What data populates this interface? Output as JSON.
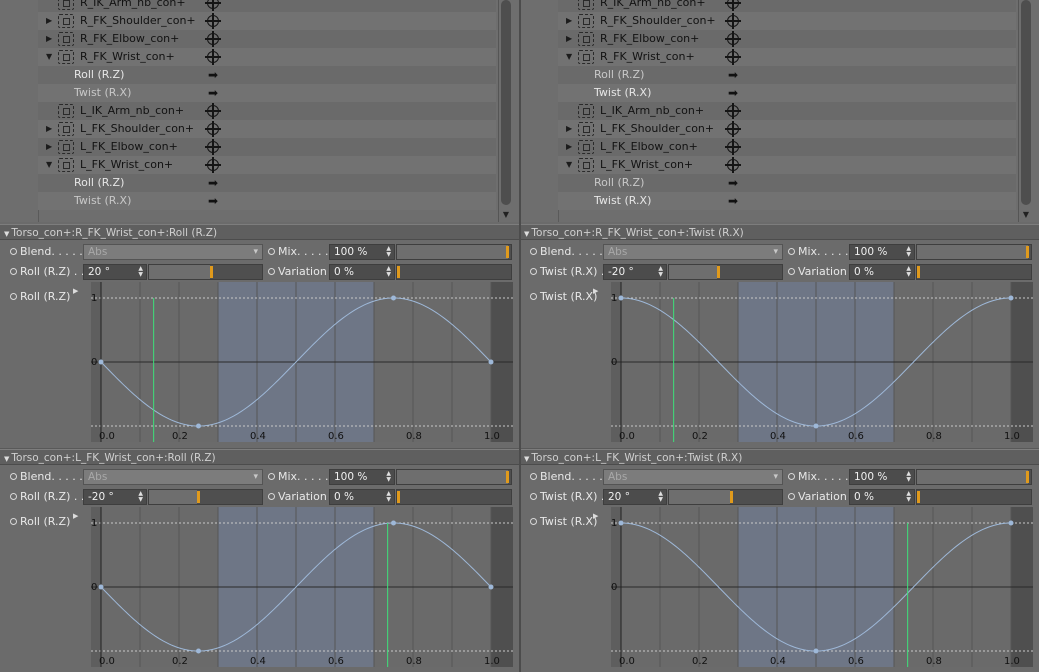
{
  "tree_left": {
    "rows": [
      {
        "kind": "ctrl",
        "expander": "",
        "label": "R_IK_Arm_nb_con+",
        "icon": "target-icon"
      },
      {
        "kind": "ctrl",
        "expander": "▶",
        "label": "R_FK_Shoulder_con+",
        "icon": "target-icon"
      },
      {
        "kind": "ctrl",
        "expander": "▶",
        "label": "R_FK_Elbow_con+",
        "icon": "target-icon"
      },
      {
        "kind": "ctrl",
        "expander": "▼",
        "label": "R_FK_Wrist_con+",
        "icon": "target-icon"
      },
      {
        "kind": "param",
        "label": "Roll (R.Z)",
        "icon": "arrow-right-icon",
        "highlight": true
      },
      {
        "kind": "param",
        "label": "Twist (R.X)",
        "icon": "arrow-right-icon",
        "highlight": false
      },
      {
        "kind": "ctrl",
        "expander": "",
        "label": "L_IK_Arm_nb_con+",
        "icon": "target-icon"
      },
      {
        "kind": "ctrl",
        "expander": "▶",
        "label": "L_FK_Shoulder_con+",
        "icon": "target-icon"
      },
      {
        "kind": "ctrl",
        "expander": "▶",
        "label": "L_FK_Elbow_con+",
        "icon": "target-icon"
      },
      {
        "kind": "ctrl",
        "expander": "▼",
        "label": "L_FK_Wrist_con+",
        "icon": "target-icon"
      },
      {
        "kind": "param",
        "label": "Roll (R.Z)",
        "icon": "arrow-right-icon",
        "highlight": true
      },
      {
        "kind": "param",
        "label": "Twist (R.X)",
        "icon": "arrow-right-icon",
        "highlight": false
      }
    ]
  },
  "tree_right": {
    "rows": [
      {
        "kind": "ctrl",
        "expander": "",
        "label": "R_IK_Arm_nb_con+",
        "icon": "target-icon"
      },
      {
        "kind": "ctrl",
        "expander": "▶",
        "label": "R_FK_Shoulder_con+",
        "icon": "target-icon"
      },
      {
        "kind": "ctrl",
        "expander": "▶",
        "label": "R_FK_Elbow_con+",
        "icon": "target-icon"
      },
      {
        "kind": "ctrl",
        "expander": "▼",
        "label": "R_FK_Wrist_con+",
        "icon": "target-icon"
      },
      {
        "kind": "param",
        "label": "Roll (R.Z)",
        "icon": "arrow-right-icon",
        "highlight": false
      },
      {
        "kind": "param",
        "label": "Twist (R.X)",
        "icon": "arrow-right-icon",
        "highlight": true
      },
      {
        "kind": "ctrl",
        "expander": "",
        "label": "L_IK_Arm_nb_con+",
        "icon": "target-icon"
      },
      {
        "kind": "ctrl",
        "expander": "▶",
        "label": "L_FK_Shoulder_con+",
        "icon": "target-icon"
      },
      {
        "kind": "ctrl",
        "expander": "▶",
        "label": "L_FK_Elbow_con+",
        "icon": "target-icon"
      },
      {
        "kind": "ctrl",
        "expander": "▼",
        "label": "L_FK_Wrist_con+",
        "icon": "target-icon"
      },
      {
        "kind": "param",
        "label": "Roll (R.Z)",
        "icon": "arrow-right-icon",
        "highlight": false
      },
      {
        "kind": "param",
        "label": "Twist (R.X)",
        "icon": "arrow-right-icon",
        "highlight": true
      }
    ]
  },
  "panels": [
    {
      "header": "Torso_con+:R_FK_Wrist_con+:Roll (R.Z)",
      "blend_label": "Blend. . . . .",
      "blend_value": "Abs",
      "mix_label": "Mix. . . . .",
      "mix_value": "100 %",
      "mix_fraction": 1.0,
      "param_label": "Roll (R.Z) . .",
      "param_value": "20 °",
      "param_fraction": 0.56,
      "variation_label": "Variation",
      "variation_value": "0 %",
      "variation_fraction": 0.0,
      "curve_label": "Roll (R.Z)",
      "curve": "sine_start_zero",
      "playhead_x": 0.135
    },
    {
      "header": "Torso_con+:R_FK_Wrist_con+:Twist (R.X)",
      "blend_label": "Blend. . . . .",
      "blend_value": "Abs",
      "mix_label": "Mix. . . . .",
      "mix_value": "100 %",
      "mix_fraction": 1.0,
      "param_label": "Twist (R.X) . .",
      "param_value": "-20 °",
      "param_fraction": 0.44,
      "variation_label": "Variation",
      "variation_value": "0 %",
      "variation_fraction": 0.0,
      "curve_label": "Twist (R.X)",
      "curve": "cosine_start_one",
      "playhead_x": 0.135
    },
    {
      "header": "Torso_con+:L_FK_Wrist_con+:Roll (R.Z)",
      "blend_label": "Blend. . . . .",
      "blend_value": "Abs",
      "mix_label": "Mix. . . . .",
      "mix_value": "100 %",
      "mix_fraction": 1.0,
      "param_label": "Roll (R.Z) . .",
      "param_value": "-20 °",
      "param_fraction": 0.44,
      "variation_label": "Variation",
      "variation_value": "0 %",
      "variation_fraction": 0.0,
      "curve_label": "Roll (R.Z)",
      "curve": "sine_start_zero",
      "playhead_x": 0.735
    },
    {
      "header": "Torso_con+:L_FK_Wrist_con+:Twist (R.X)",
      "blend_label": "Blend. . . . .",
      "blend_value": "Abs",
      "mix_label": "Mix. . . . .",
      "mix_value": "100 %",
      "mix_fraction": 1.0,
      "param_label": "Twist (R.X) . .",
      "param_value": "20 °",
      "param_fraction": 0.56,
      "variation_label": "Variation",
      "variation_value": "0 %",
      "variation_fraction": 0.0,
      "curve_label": "Twist (R.X)",
      "curve": "cosine_start_one",
      "playhead_x": 0.735
    }
  ],
  "graph_axis": {
    "x_ticks": [
      "0.0",
      "0.2",
      "0.4",
      "0.6",
      "0.8",
      "1.0"
    ],
    "y_ticks": [
      "1",
      "0",
      "-1"
    ]
  },
  "colors": {
    "slider_knob": "#e09a1c",
    "curve": "#9eb8d8",
    "playhead": "#3ee07a"
  }
}
